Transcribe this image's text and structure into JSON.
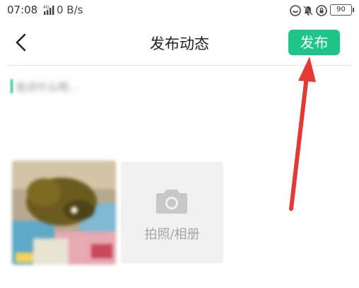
{
  "status_bar": {
    "time": "07:08",
    "network": "4G",
    "speed": "0 B/s",
    "battery": "90",
    "icons": [
      "sync-icon",
      "bell-off-icon",
      "lock-rotation-icon",
      "battery-icon"
    ]
  },
  "header": {
    "back_icon": "chevron-left-icon",
    "title": "发布动态",
    "publish_label": "发布"
  },
  "composer": {
    "placeholder": "说点什么吧…"
  },
  "media": {
    "add_label": "拍照/相册",
    "add_icon": "camera-icon"
  },
  "colors": {
    "accent": "#1fc48a",
    "annotation_arrow": "#e53935",
    "tile_bg": "#f1f1f1"
  }
}
